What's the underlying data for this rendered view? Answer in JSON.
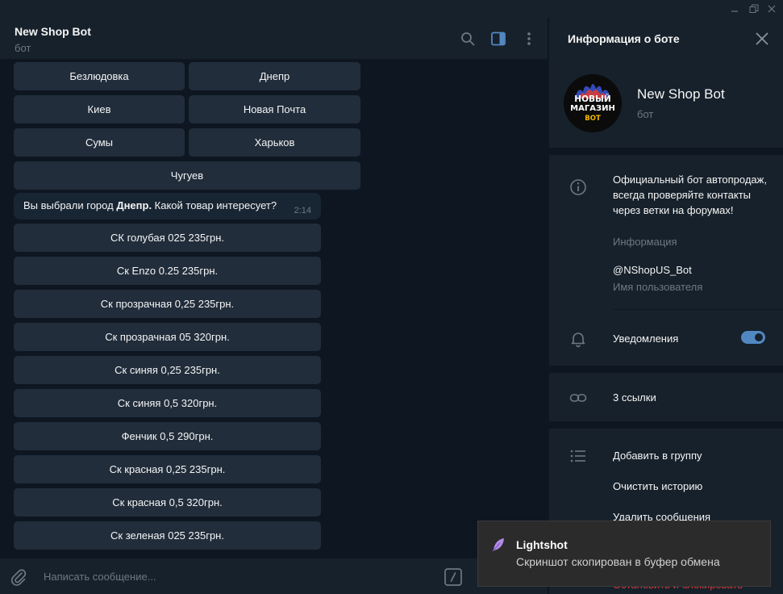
{
  "chat": {
    "title": "New Shop Bot",
    "status": "бот",
    "city_buttons": [
      "Безлюдовка",
      "Днепр",
      "Киев",
      "Новая Почта",
      "Сумы",
      "Харьков",
      "Чугуев"
    ],
    "message": {
      "prefix": "Вы выбрали город ",
      "city": "Днепр.",
      "suffix": " Какой товар интересует?",
      "time": "2:14"
    },
    "product_buttons": [
      "СК голубая 025 235грн.",
      "Ск Enzo 0.25 235грн.",
      "Ск прозрачная 0,25 235грн.",
      "Ск прозрачная 05 320грн.",
      "Ск синяя 0,25 235грн.",
      "Ск синяя 0,5 320грн.",
      "Фенчик 0,5 290грн.",
      "Ск красная 0,25 235грн.",
      "Ск красная 0,5 320грн.",
      "Ск зеленая 025 235грн."
    ],
    "composer_placeholder": "Написать сообщение..."
  },
  "panel": {
    "title": "Информация о боте",
    "bot_name": "New Shop Bot",
    "bot_sub": "бот",
    "avatar_lines": [
      "НОВЫЙ",
      "МАГАЗИН",
      "BOT"
    ],
    "description": "Официальный бот автопродаж, всегда проверяйте контакты через ветки на форумах!",
    "description_label": "Информация",
    "username": "@NShopUS_Bot",
    "username_label": "Имя пользователя",
    "notifications_label": "Уведомления",
    "notifications_on": true,
    "links_label": "3 ссылки",
    "actions": [
      "Добавить в группу",
      "Очистить историю",
      "Удалить сообщения"
    ],
    "danger_action": "Остановить и блокировать"
  },
  "toast": {
    "title": "Lightshot",
    "message": "Скриншот скопирован в буфер обмена"
  },
  "colors": {
    "accent": "#5288c1",
    "background": "#0e1621",
    "panel": "#17212b",
    "button": "#212d3b",
    "danger": "#e53935"
  }
}
